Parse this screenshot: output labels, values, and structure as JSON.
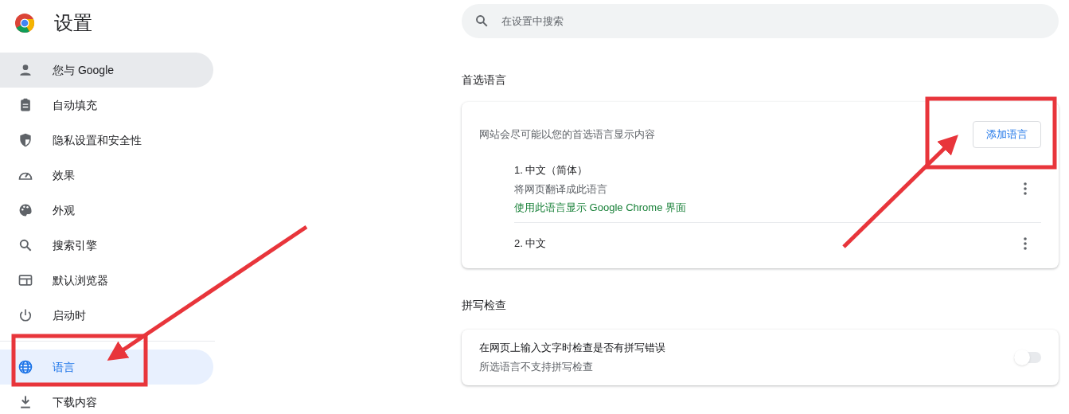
{
  "header": {
    "title": "设置"
  },
  "sidebar": {
    "items": [
      {
        "label": "您与 Google",
        "selected": false,
        "hovered": true
      },
      {
        "label": "自动填充",
        "selected": false,
        "hovered": false
      },
      {
        "label": "隐私设置和安全性",
        "selected": false,
        "hovered": false
      },
      {
        "label": "效果",
        "selected": false,
        "hovered": false
      },
      {
        "label": "外观",
        "selected": false,
        "hovered": false
      },
      {
        "label": "搜索引擎",
        "selected": false,
        "hovered": false
      },
      {
        "label": "默认浏览器",
        "selected": false,
        "hovered": false
      },
      {
        "label": "启动时",
        "selected": false,
        "hovered": false
      },
      {
        "label": "语言",
        "selected": true,
        "hovered": false
      },
      {
        "label": "下载内容",
        "selected": false,
        "hovered": false
      }
    ]
  },
  "search": {
    "placeholder": "在设置中搜索"
  },
  "preferred_languages": {
    "heading": "首选语言",
    "description": "网站会尽可能以您的首选语言显示内容",
    "add_button": "添加语言",
    "languages": [
      {
        "name": "1. 中文（简体）",
        "note": "将网页翻译成此语言",
        "ui_note": "使用此语言显示 Google Chrome 界面"
      },
      {
        "name": "2. 中文"
      }
    ]
  },
  "spell_check": {
    "heading": "拼写检查",
    "title": "在网页上输入文字时检查是否有拼写错误",
    "subtitle": "所选语言不支持拼写检查",
    "on": false
  }
}
